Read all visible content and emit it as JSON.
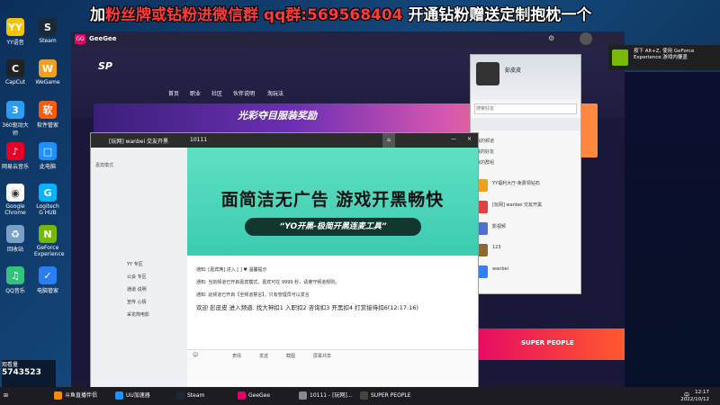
{
  "overlay": {
    "banner_prefix": "加",
    "banner_red": "粉丝牌或钻粉进微信群",
    "banner_qq": "qq群:569568404",
    "banner_suffix": "开通钻粉赠送定制抱枕一个"
  },
  "desktop_icons": [
    {
      "label": "YY语音",
      "color": "#f5c400",
      "glyph": "YY"
    },
    {
      "label": "Steam",
      "color": "#1b2838",
      "glyph": "S"
    },
    {
      "label": "CapCut",
      "color": "#222",
      "glyph": "C"
    },
    {
      "label": "WeGame",
      "color": "#f0a020",
      "glyph": "W"
    },
    {
      "label": "360驱动大师",
      "color": "#2a9df4",
      "glyph": "3"
    },
    {
      "label": "软件管家",
      "color": "#ff5a00",
      "glyph": "软"
    },
    {
      "label": "网易云音乐",
      "color": "#e60026",
      "glyph": "♪"
    },
    {
      "label": "此电脑",
      "color": "#1e90ff",
      "glyph": "□"
    },
    {
      "label": "Google Chrome",
      "color": "#fff",
      "glyph": "◉"
    },
    {
      "label": "Logitech G HUB",
      "color": "#00b4ff",
      "glyph": "G"
    },
    {
      "label": "回收站",
      "color": "#7aa0c8",
      "glyph": "♻"
    },
    {
      "label": "GeForce Experience",
      "color": "#76b900",
      "glyph": "N"
    },
    {
      "label": "QQ音乐",
      "color": "#31c27c",
      "glyph": "♫"
    },
    {
      "label": "电脑管家",
      "color": "#2a7ef4",
      "glyph": "✓"
    }
  ],
  "browser": {
    "brand": "GeeGee",
    "nav": [
      "首页",
      "职业",
      "社区",
      "伙伴说明",
      "淘玩法"
    ],
    "banner_text": "光彩夺目服装奖励",
    "promo_text": "SUPER PEOPLE"
  },
  "yy": {
    "title": "[玩网] wanbei 交友开黑",
    "channel_id": "10111",
    "left_header": "嘉宾模式",
    "left_rows": [
      "YY 专区",
      "公会 专区",
      "通道 说明",
      "宣传 心情",
      "采花简电影"
    ],
    "ad_title": "面简洁无广告  游戏开黑畅快",
    "ad_pill": "“YO开黑-极简开黑连麦工具”",
    "chat_lines": [
      "通知: [嘉宾席] 进入 [ ]  ♥ 温馨提示",
      "通知: 当前频道已开启嘉宾模式，嘉宾可在 9999 秒，请遵守频道规则。",
      "通知: 此频道已开启【全频道禁言】，只有管理员可以发言"
    ],
    "chat_last": "欢迎 彭皮皮 进入频道. 找大神扣1 入职扣2 咨询扣3 开黑扣4 打赏接待扣6(12:17:16)",
    "input_toolbar": [
      "表情",
      "发送",
      "截图",
      "屏幕共享"
    ]
  },
  "friends": {
    "nickname": "彭皮皮",
    "search_placeholder": "搜索好友",
    "groups": [
      "我的频道",
      "我的好友",
      "我的群组"
    ],
    "rows": [
      {
        "name": "YY福利大厅-免费领钻石",
        "color": "#f0a020"
      },
      {
        "name": "[玩网] wanbei 交友开黑",
        "color": "#e04040"
      },
      {
        "name": "影视频",
        "color": "#5070d0"
      },
      {
        "name": "123",
        "color": "#8a6a30"
      },
      {
        "name": "wanbei",
        "color": "#3080ff"
      }
    ]
  },
  "nvidia": {
    "line1": "按下 Alt+Z, 使用 GeForce",
    "line2": "Experience 游戏内覆盖"
  },
  "counter": {
    "label": "观看量",
    "value": "5743523"
  },
  "taskbar": {
    "items": [
      "斗鱼直播伴侣",
      "UU加速器",
      "Steam",
      "GeeGee",
      "10111 - [玩网]...",
      "SUPER PEOPLE"
    ],
    "time": "12:17",
    "date": "2022/10/12",
    "lang": "中"
  }
}
